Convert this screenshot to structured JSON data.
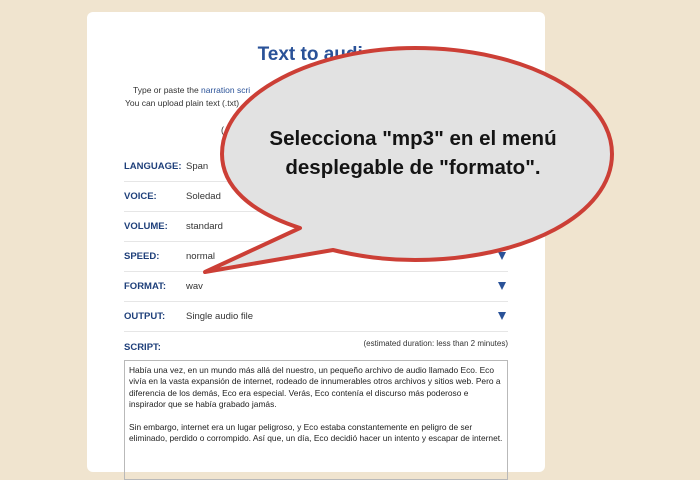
{
  "page": {
    "title": "Text to audio",
    "intro_line1_prefix": "Type or paste the ",
    "intro_link": "narration scri",
    "intro_line2": "You can upload plain text (.txt)",
    "paren_fragment": "("
  },
  "form": {
    "language": {
      "label": "LANGUAGE:",
      "value": "Span"
    },
    "voice": {
      "label": "VOICE:",
      "value": "Soledad"
    },
    "volume": {
      "label": "VOLUME:",
      "value": "standard"
    },
    "speed": {
      "label": "SPEED:",
      "value": "normal"
    },
    "format": {
      "label": "FORMAT:",
      "value": "wav"
    },
    "output": {
      "label": "OUTPUT:",
      "value": "Single audio file"
    }
  },
  "script": {
    "label": "SCRIPT:",
    "duration": "(estimated duration: less than 2 minutes)",
    "paragraph1": "Había una vez, en un mundo más allá del nuestro, un pequeño archivo de audio llamado Eco. Eco vivía en la vasta expansión de internet, rodeado de innumerables otros archivos y sitios web. Pero a diferencia de los demás, Eco era especial. Verás, Eco contenía el discurso más poderoso e inspirador que se había grabado jamás.",
    "paragraph2": "Sin embargo, internet era un lugar peligroso, y Eco estaba constantemente en peligro de ser eliminado, perdido o corrompido. Así que, un día, Eco decidió hacer un intento y escapar de internet."
  },
  "callout": {
    "line1": "Selecciona \"mp3\" en el menú",
    "line2": "desplegable de \"formato\".",
    "fill_color": "#e2e2e2",
    "stroke_color": "#cc3f36"
  },
  "colors": {
    "background": "#f0e4cf",
    "accent": "#2a5298",
    "label": "#1e3f7a"
  },
  "icons": {
    "dropdown": "triangle-down-icon"
  }
}
